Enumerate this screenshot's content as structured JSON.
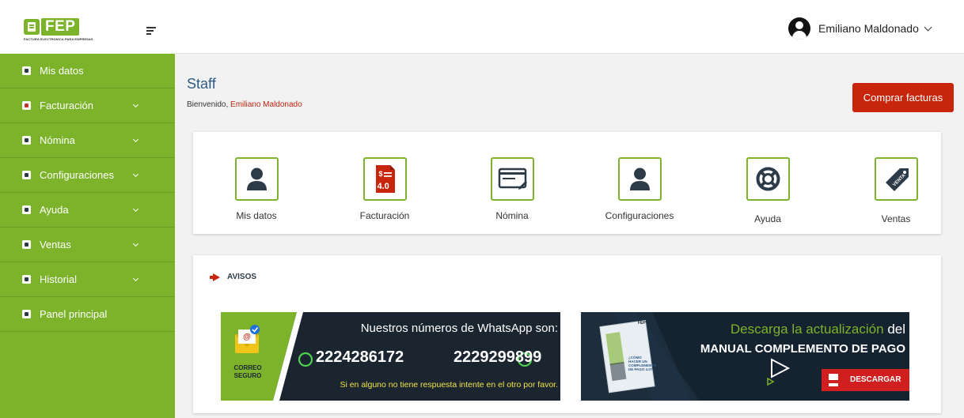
{
  "brand": {
    "logo_text": "FEP",
    "tagline": "FACTURA ELECTRONICA PARA EMPRESAS"
  },
  "header": {
    "user_name": "Emiliano Maldonado"
  },
  "sidebar": {
    "items": [
      {
        "label": "Mis datos",
        "icon": "user-icon",
        "has_submenu": false
      },
      {
        "label": "Facturación",
        "icon": "invoice-icon",
        "has_submenu": true
      },
      {
        "label": "Nómina",
        "icon": "payroll-icon",
        "has_submenu": true
      },
      {
        "label": "Configuraciones",
        "icon": "gear-icon",
        "has_submenu": true
      },
      {
        "label": "Ayuda",
        "icon": "lifebuoy-icon",
        "has_submenu": true
      },
      {
        "label": "Ventas",
        "icon": "tag-icon",
        "has_submenu": true
      },
      {
        "label": "Historial",
        "icon": "search-icon",
        "has_submenu": true
      },
      {
        "label": "Panel principal",
        "icon": "monitor-icon",
        "has_submenu": false
      }
    ]
  },
  "main": {
    "title": "Staff",
    "welcome_prefix": "Bienvenido,",
    "welcome_name": "Emiliano Maldonado",
    "buy_button": "Comprar facturas"
  },
  "shortcuts": [
    {
      "label": "Mis datos",
      "icon": "user-icon"
    },
    {
      "label": "Facturación",
      "icon": "invoice-4-0-icon",
      "badge": "4.0"
    },
    {
      "label": "Nómina",
      "icon": "payroll-check-icon"
    },
    {
      "label": "Configuraciones",
      "icon": "user-icon"
    },
    {
      "label": "Ayuda",
      "icon": "lifebuoy-icon"
    },
    {
      "label": "Ventas",
      "icon": "sale-tag-icon",
      "badge": "VENTA"
    }
  ],
  "avisos": {
    "title": "AVISOS",
    "banner_whatsapp": {
      "heading": "Nuestros números de WhatsApp son:",
      "phone1": "2224286172",
      "phone2": "2229299899",
      "footer": "Si en alguno no tiene respuesta intente en el otro por favor.",
      "badge_line1": "CORREO",
      "badge_line2": "SEGURO"
    },
    "banner_pdf": {
      "heading_part1": "Descarga la actualización",
      "heading_part2": "del",
      "subheading": "MANUAL COMPLEMENTO DE PAGO",
      "button": "DESCARGAR",
      "brochure_text": "¿CÓMO HACER UN COMPLEMENTO DE PAGO 4.0?",
      "brochure_logo": "FEP"
    }
  },
  "colors": {
    "sidebar": "#7cb32a",
    "accent_red": "#c7250c",
    "title_blue": "#2d5a85",
    "whatsapp_green": "#4fd14f",
    "banner_yellow": "#f0e14a"
  }
}
